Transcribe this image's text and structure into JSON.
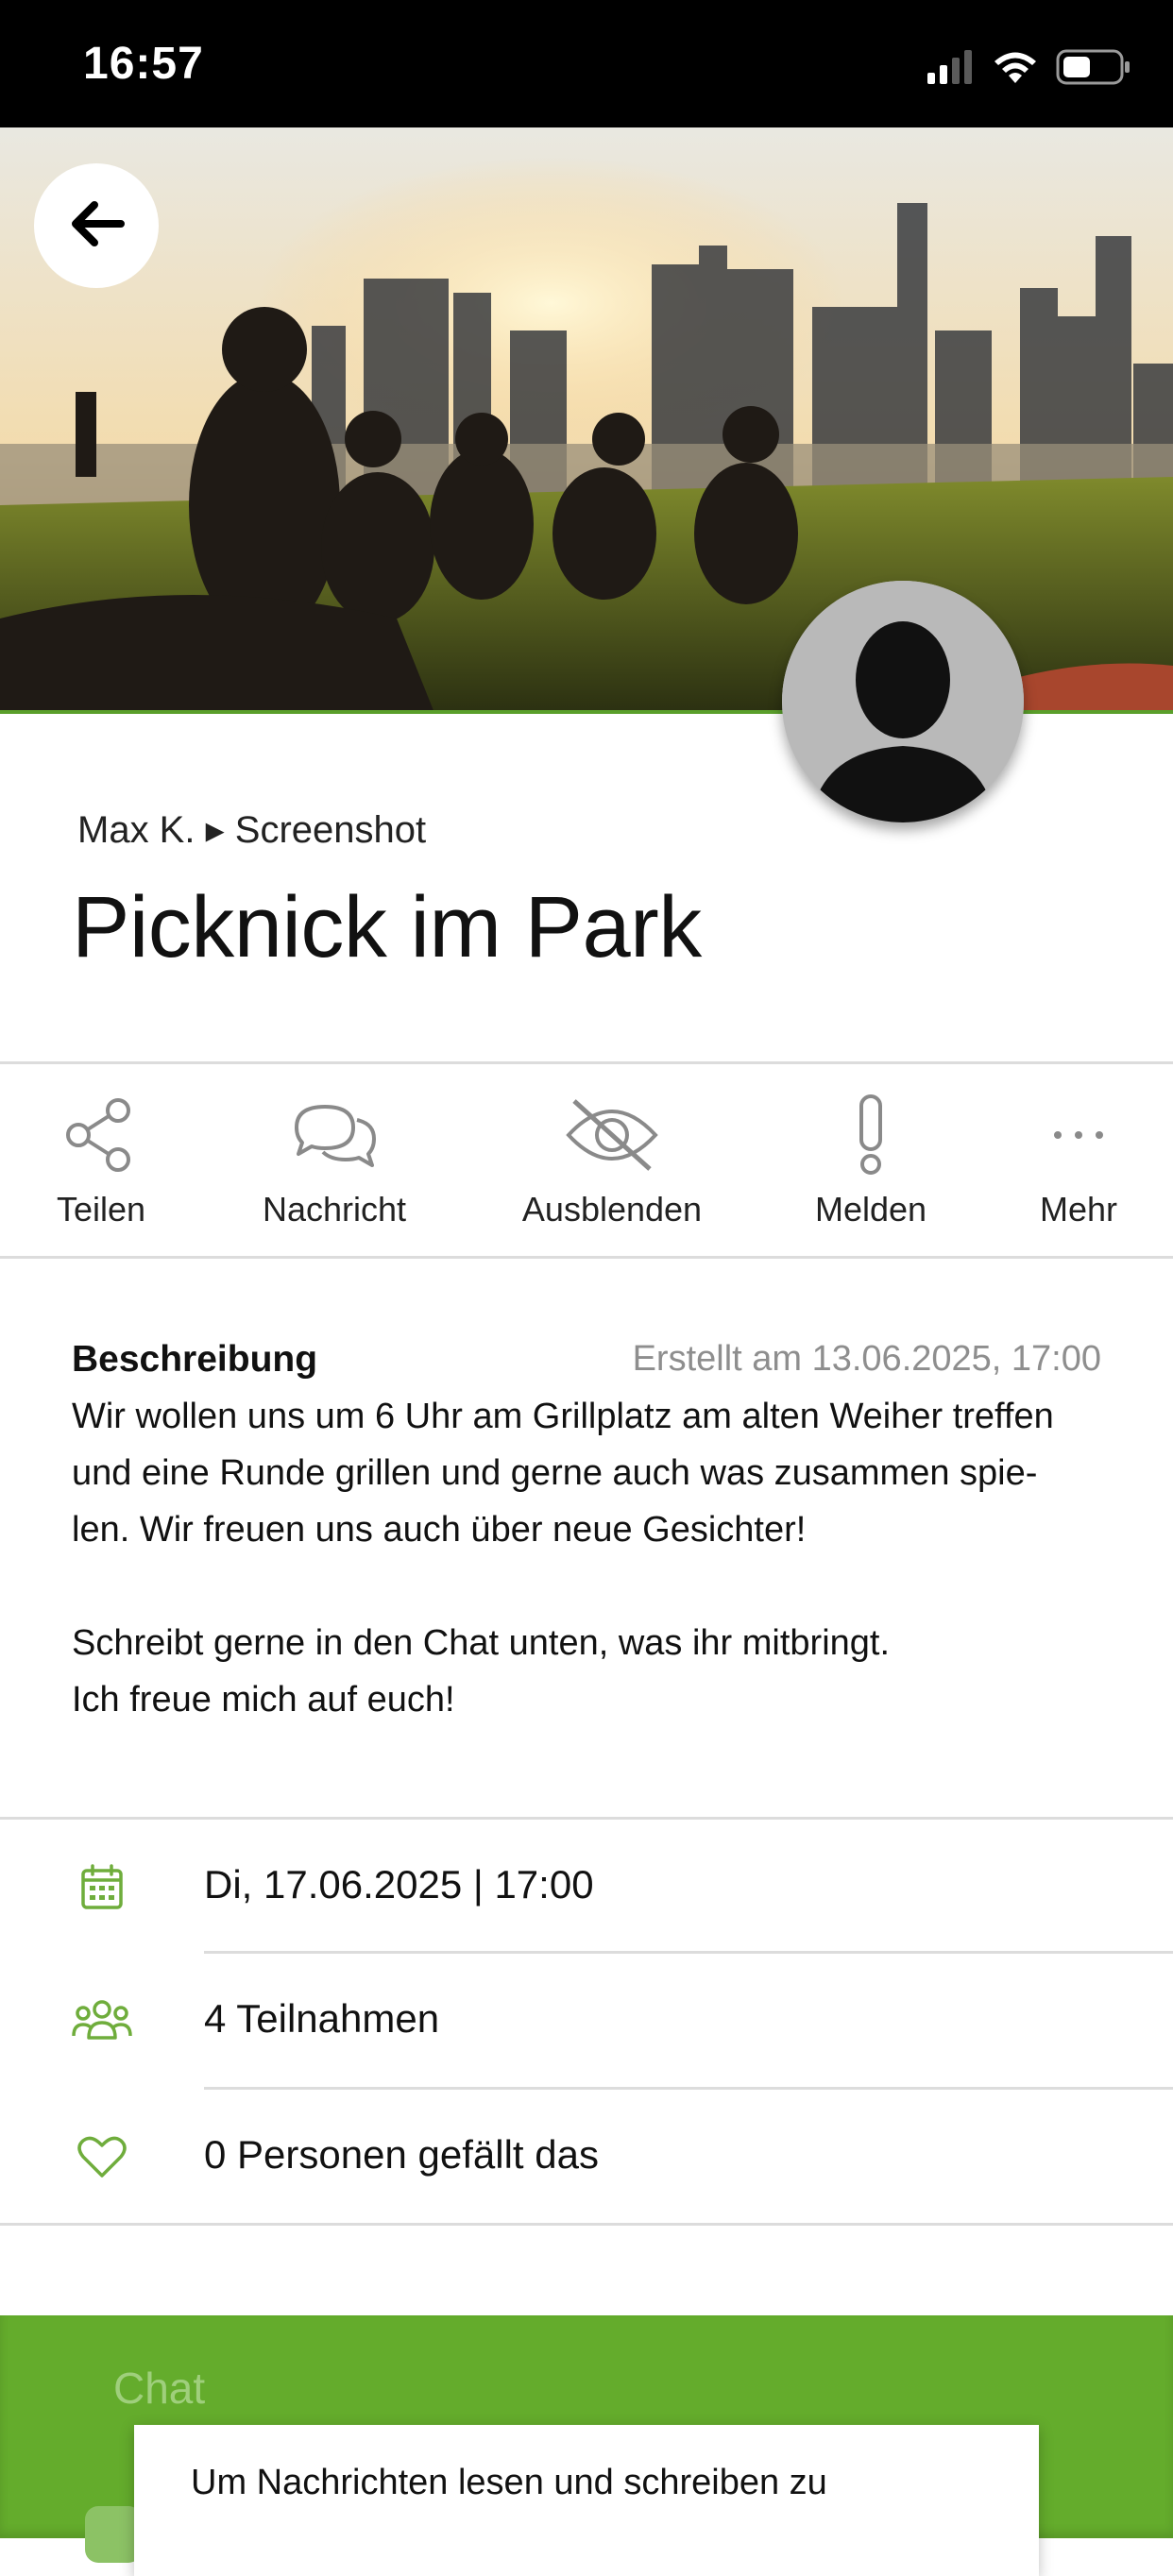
{
  "status_bar": {
    "time": "16:57"
  },
  "hero": {
    "image": "park-picnic-skyline-photo"
  },
  "nav": {
    "back_icon": "arrow-left-icon"
  },
  "header": {
    "breadcrumb": "Max K. ▸ Screenshot",
    "title": "Picknick im Park"
  },
  "actions": [
    {
      "label": "Teilen",
      "icon": "share-icon"
    },
    {
      "label": "Nachricht",
      "icon": "chat-bubbles-icon"
    },
    {
      "label": "Ausblenden",
      "icon": "eye-slash-icon"
    },
    {
      "label": "Melden",
      "icon": "exclamation-icon"
    },
    {
      "label": "Mehr",
      "icon": "more-dots-icon"
    }
  ],
  "description": {
    "heading": "Beschreibung",
    "created": "Erstellt am 13.06.2025, 17:00",
    "lines": [
      "Wir wollen uns um 6 Uhr am Grillplatz am alten Weiher treffen",
      "und eine Runde grillen und gerne auch was zusammen spie-",
      "len. Wir freuen uns auch über neue Gesichter!"
    ],
    "lines2": [
      "Schreibt gerne in den Chat unten, was ihr mitbringt.",
      "Ich freue mich auf euch!"
    ]
  },
  "info": {
    "date": "Di, 17.06.2025 | 17:00",
    "participants": "4 Teilnahmen",
    "likes": "0 Personen gefällt das"
  },
  "chat": {
    "title": "Chat",
    "notice": "Um Nachrichten lesen und schreiben zu"
  },
  "colors": {
    "accent": "#5a9f2b",
    "chat_bg": "#64ac2c"
  }
}
